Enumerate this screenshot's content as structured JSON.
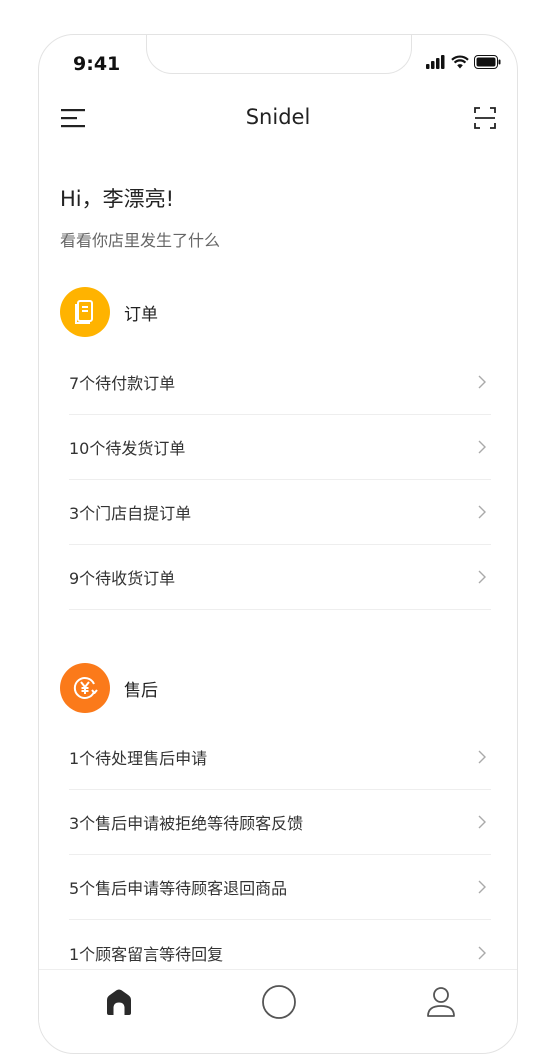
{
  "status": {
    "time": "9:41"
  },
  "header": {
    "title": "Snidel",
    "menu_icon": "menu-icon",
    "scan_icon": "scan-icon"
  },
  "greeting": {
    "hello": "Hi，李漂亮!",
    "subtitle": "看看你店里发生了什么"
  },
  "orders": {
    "title": "订单",
    "icon": "order-document-icon",
    "icon_color": "#FFB300",
    "items": [
      {
        "label": "7个待付款订单"
      },
      {
        "label": "10个待发货订单"
      },
      {
        "label": "3个门店自提订单"
      },
      {
        "label": "9个待收货订单"
      }
    ]
  },
  "aftersales": {
    "title": "售后",
    "icon": "refund-yuan-icon",
    "icon_color": "#FB7A1A",
    "items": [
      {
        "label": "1个待处理售后申请"
      },
      {
        "label": "3个售后申请被拒绝等待顾客反馈"
      },
      {
        "label": "5个售后申请等待顾客退回商品"
      },
      {
        "label": "1个顾客留言等待回复"
      }
    ]
  },
  "tabbar": {
    "tabs": [
      "home-icon",
      "circle-icon",
      "user-icon"
    ]
  }
}
